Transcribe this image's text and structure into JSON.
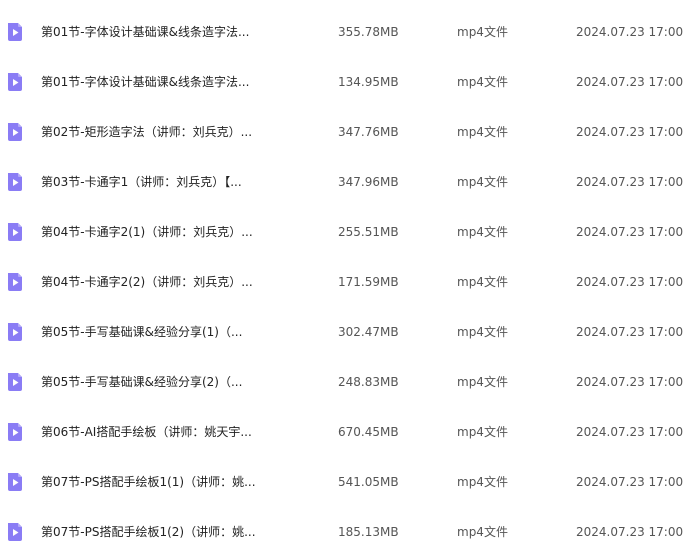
{
  "colors": {
    "icon_fill": "#8a7cf5",
    "icon_glyph": "#ffffff"
  },
  "files": [
    {
      "name": "第01节-字体设计基础课&线条造字法...",
      "size": "355.78MB",
      "type": "mp4文件",
      "date": "2024.07.23 17:00",
      "icon": "video-file-icon"
    },
    {
      "name": "第01节-字体设计基础课&线条造字法...",
      "size": "134.95MB",
      "type": "mp4文件",
      "date": "2024.07.23 17:00",
      "icon": "video-file-icon"
    },
    {
      "name": "第02节-矩形造字法（讲师：刘兵克）...",
      "size": "347.76MB",
      "type": "mp4文件",
      "date": "2024.07.23 17:00",
      "icon": "video-file-icon"
    },
    {
      "name": "第03节-卡通字1（讲师：刘兵克）【...",
      "size": "347.96MB",
      "type": "mp4文件",
      "date": "2024.07.23 17:00",
      "icon": "video-file-icon"
    },
    {
      "name": "第04节-卡通字2(1)（讲师：刘兵克）...",
      "size": "255.51MB",
      "type": "mp4文件",
      "date": "2024.07.23 17:00",
      "icon": "video-file-icon"
    },
    {
      "name": "第04节-卡通字2(2)（讲师：刘兵克）...",
      "size": "171.59MB",
      "type": "mp4文件",
      "date": "2024.07.23 17:00",
      "icon": "video-file-icon"
    },
    {
      "name": "第05节-手写基础课&经验分享(1)（...",
      "size": "302.47MB",
      "type": "mp4文件",
      "date": "2024.07.23 17:00",
      "icon": "video-file-icon"
    },
    {
      "name": "第05节-手写基础课&经验分享(2)（...",
      "size": "248.83MB",
      "type": "mp4文件",
      "date": "2024.07.23 17:00",
      "icon": "video-file-icon"
    },
    {
      "name": "第06节-AI搭配手绘板（讲师：姚天宇...",
      "size": "670.45MB",
      "type": "mp4文件",
      "date": "2024.07.23 17:00",
      "icon": "video-file-icon"
    },
    {
      "name": "第07节-PS搭配手绘板1(1)（讲师：姚...",
      "size": "541.05MB",
      "type": "mp4文件",
      "date": "2024.07.23 17:00",
      "icon": "video-file-icon"
    },
    {
      "name": "第07节-PS搭配手绘板1(2)（讲师：姚...",
      "size": "185.13MB",
      "type": "mp4文件",
      "date": "2024.07.23 17:00",
      "icon": "video-file-icon"
    }
  ]
}
